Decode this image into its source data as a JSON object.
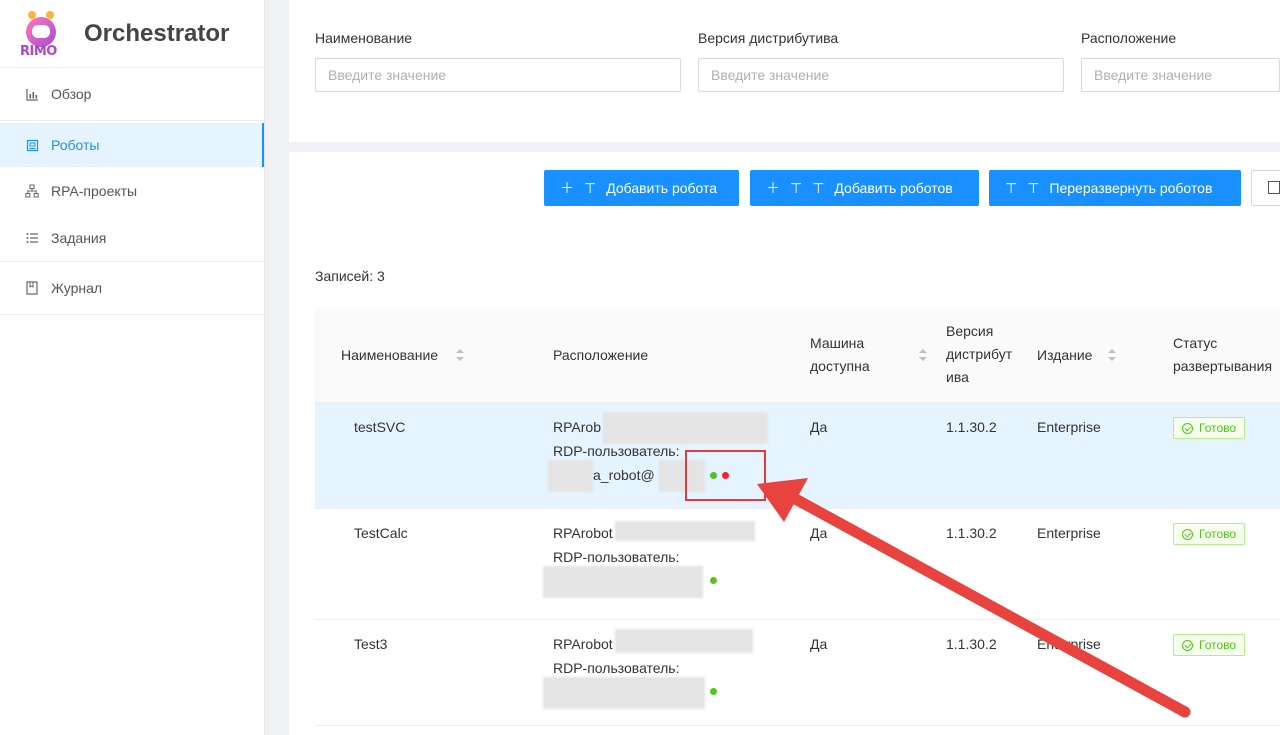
{
  "app": {
    "title": "Orchestrator",
    "logo_text": "RIMO"
  },
  "sidebar": {
    "items": [
      {
        "label": "Обзор",
        "icon": "bar-chart-icon"
      },
      {
        "label": "Роботы",
        "icon": "robot-icon",
        "active": true
      },
      {
        "label": "RPA-проекты",
        "icon": "hierarchy-icon"
      },
      {
        "label": "Задания",
        "icon": "list-icon"
      },
      {
        "label": "Журнал",
        "icon": "journal-icon"
      }
    ]
  },
  "filters": [
    {
      "label": "Наименование",
      "placeholder": "Введите значение"
    },
    {
      "label": "Версия дистрибутива",
      "placeholder": "Введите значение"
    },
    {
      "label": "Расположение",
      "placeholder": "Введите значение"
    }
  ],
  "toolbar": {
    "add_robot": "Добавить робота",
    "add_robots": "Добавить роботов",
    "redeploy": "Переразвернуть роботов"
  },
  "records": "Записей: 3",
  "table": {
    "headers": {
      "name": "Наименование",
      "location": "Расположение",
      "machine_l1": "Машина",
      "machine_l2": "доступна",
      "version_l1": "Версия",
      "version_l2": "дистрибут",
      "version_l3": "ива",
      "edition": "Издание",
      "status_l1": "Статус",
      "status_l2": "развертывания"
    },
    "rows": [
      {
        "name": "testSVC",
        "loc1": "RPArob",
        "loc2": "RDP-пользователь:",
        "loc3": "a_robot@",
        "machine": "Да",
        "version": "1.1.30.2",
        "edition": "Enterprise",
        "status": "Готово"
      },
      {
        "name": "TestCalc",
        "loc1": "RPArobot",
        "loc2": "RDP-пользователь:",
        "loc3": "",
        "machine": "Да",
        "version": "1.1.30.2",
        "edition": "Enterprise",
        "status": "Готово"
      },
      {
        "name": "Test3",
        "loc1": "RPArobot",
        "loc2": "RDP-пользователь:",
        "loc3": "",
        "machine": "Да",
        "version": "1.1.30.2",
        "edition": "Enterprise",
        "status": "Готово"
      }
    ]
  },
  "colors": {
    "primary": "#1890ff",
    "success": "#52c41a",
    "danger": "#f5222d",
    "annotation": "#e23b3b"
  }
}
